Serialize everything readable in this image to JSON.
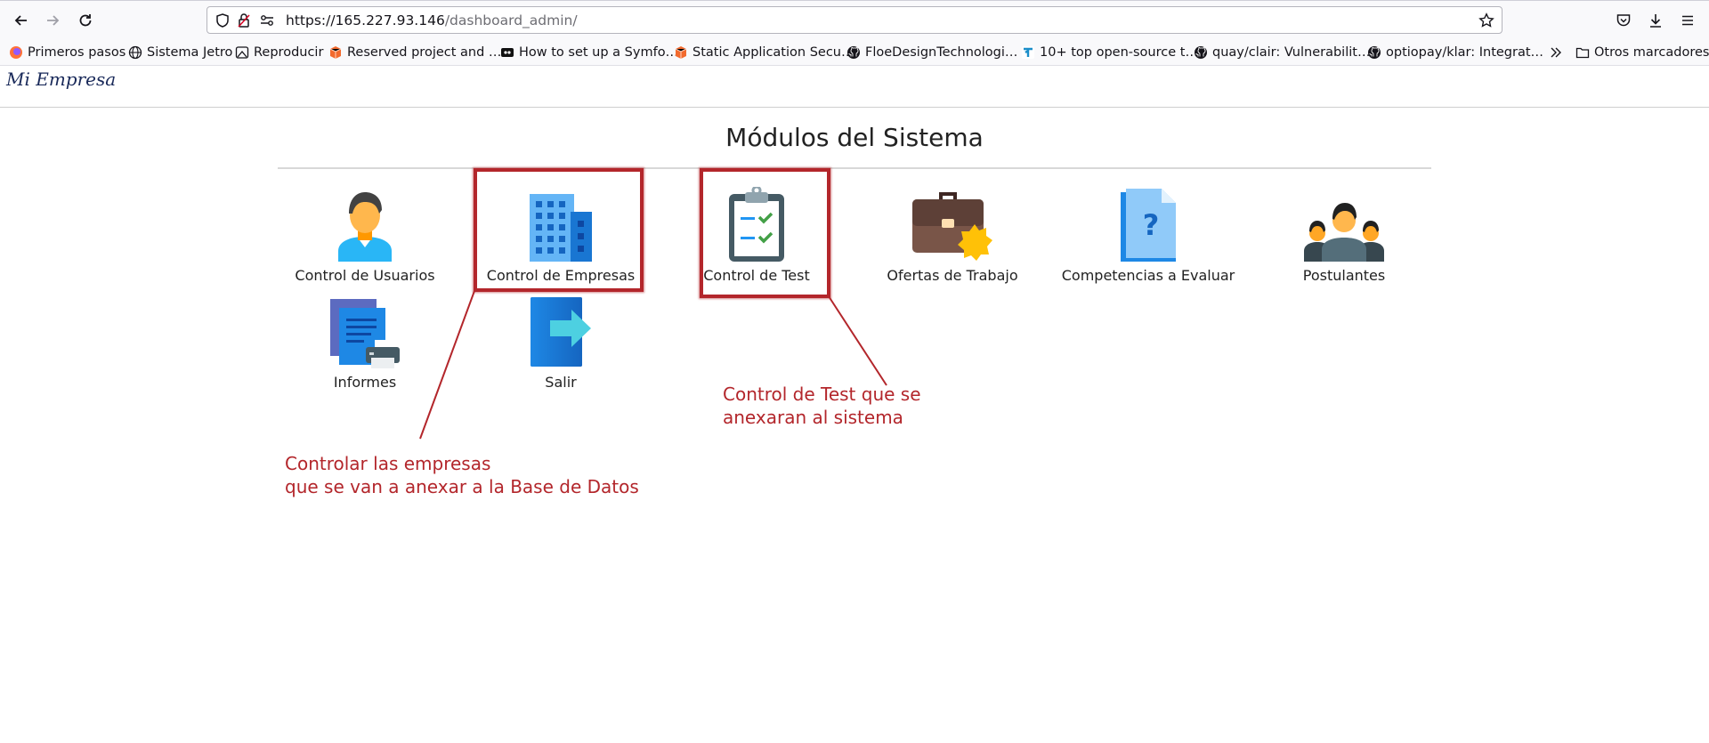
{
  "browser": {
    "url_host": "https://165.227.93.146",
    "url_path": "/dashboard_admin/",
    "bookmarks": [
      {
        "label": "Primeros pasos",
        "icon": "firefox-icon"
      },
      {
        "label": "Sistema Jetro",
        "icon": "globe-icon"
      },
      {
        "label": "Reproducir",
        "icon": "play-icon"
      },
      {
        "label": "Reserved project and …",
        "icon": "package-icon"
      },
      {
        "label": "How to set up a Symfo…",
        "icon": "video-icon"
      },
      {
        "label": "Static Application Secu…",
        "icon": "package-icon"
      },
      {
        "label": "FloeDesignTechnologi…",
        "icon": "github-icon"
      },
      {
        "label": "10+ top open-source t…",
        "icon": "bookmark-t-icon"
      },
      {
        "label": "quay/clair: Vulnerabilit…",
        "icon": "github-icon"
      },
      {
        "label": "optiopay/klar: Integrat…",
        "icon": "github-icon"
      }
    ],
    "other_bookmarks": "Otros marcadores"
  },
  "site": {
    "brand": "Mi Empresa"
  },
  "main": {
    "title": "Módulos del Sistema",
    "modules": [
      {
        "label": "Control de Usuarios",
        "icon": "user-icon"
      },
      {
        "label": "Control de Empresas",
        "icon": "building-icon"
      },
      {
        "label": "Control de Test",
        "icon": "clipboard-check-icon"
      },
      {
        "label": "Ofertas de Trabajo",
        "icon": "briefcase-icon"
      },
      {
        "label": "Competencias a Evaluar",
        "icon": "question-document-icon"
      },
      {
        "label": "Postulantes",
        "icon": "group-icon"
      },
      {
        "label": "Informes",
        "icon": "print-reports-icon"
      },
      {
        "label": "Salir",
        "icon": "exit-icon"
      }
    ]
  },
  "annotations": {
    "empresas_note": "Controlar las empresas\nque se van a anexar a la Base de Datos",
    "test_note": "Control de Test que se\nanexaran al sistema",
    "color": "#b3262b"
  }
}
